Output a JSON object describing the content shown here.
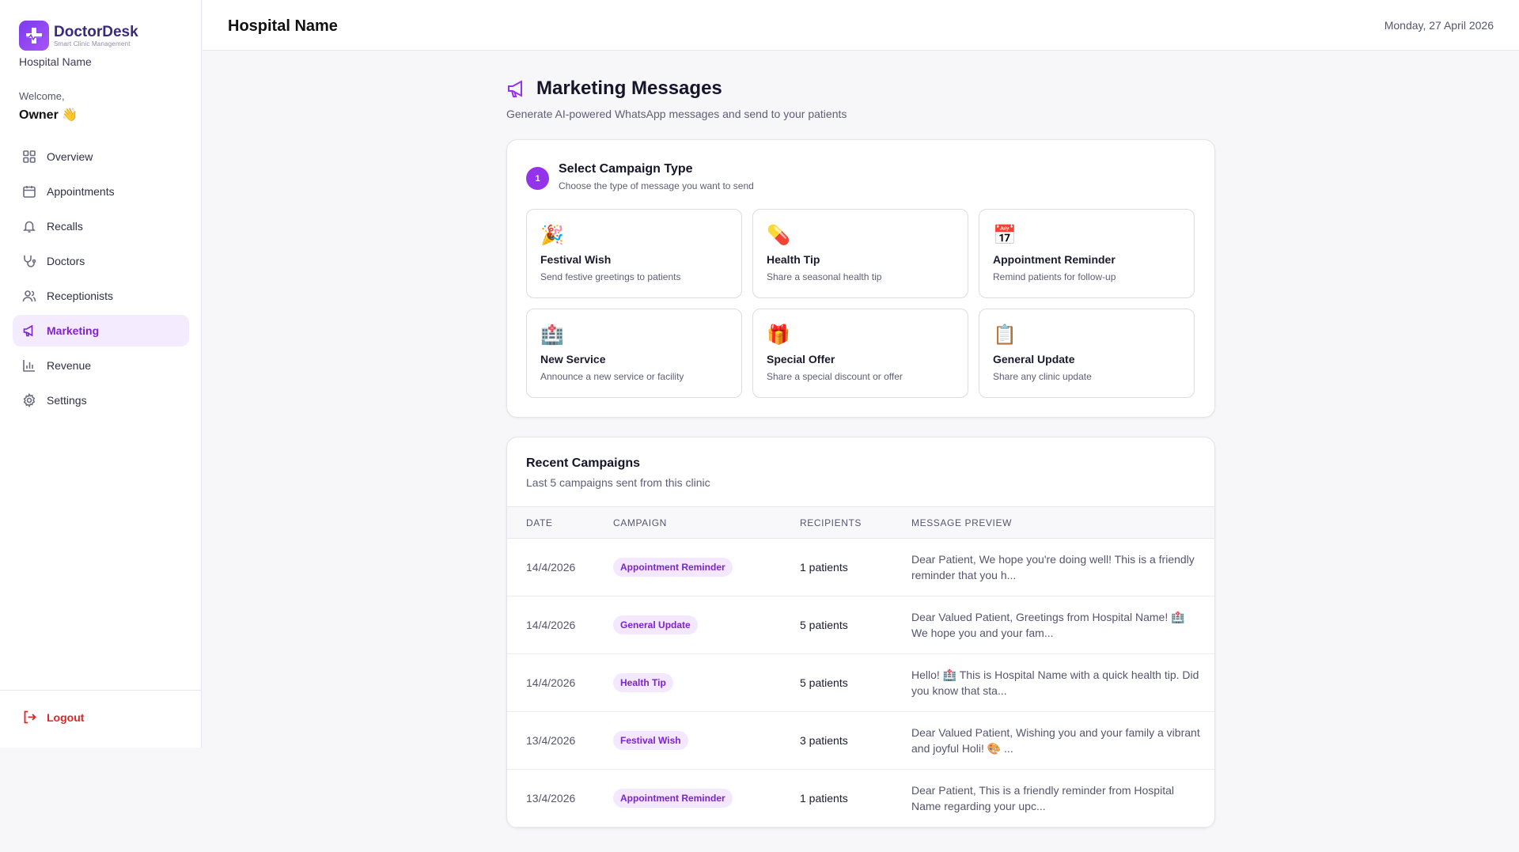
{
  "brand": {
    "name": "DoctorDesk",
    "tagline": "Smart Clinic Management",
    "hospital": "Hospital Name"
  },
  "sidebar": {
    "welcome": "Welcome,",
    "user": "Owner",
    "wave": "👋",
    "items": [
      {
        "label": "Overview",
        "icon": "grid-icon"
      },
      {
        "label": "Appointments",
        "icon": "calendar-icon"
      },
      {
        "label": "Recalls",
        "icon": "bell-icon"
      },
      {
        "label": "Doctors",
        "icon": "stethoscope-icon"
      },
      {
        "label": "Receptionists",
        "icon": "users-icon"
      },
      {
        "label": "Marketing",
        "icon": "megaphone-icon",
        "active": true
      },
      {
        "label": "Revenue",
        "icon": "bar-chart-icon"
      },
      {
        "label": "Settings",
        "icon": "gear-icon"
      }
    ],
    "logout": "Logout"
  },
  "header": {
    "title": "Hospital Name",
    "date": "Monday, 27 April 2026"
  },
  "page": {
    "title": "Marketing Messages",
    "subtitle": "Generate AI-powered WhatsApp messages and send to your patients"
  },
  "campaign": {
    "step": "1",
    "title": "Select Campaign Type",
    "subtitle": "Choose the type of message you want to send",
    "types": [
      {
        "emoji": "🎉",
        "title": "Festival Wish",
        "desc": "Send festive greetings to patients"
      },
      {
        "emoji": "💊",
        "title": "Health Tip",
        "desc": "Share a seasonal health tip"
      },
      {
        "emoji": "📅",
        "title": "Appointment Reminder",
        "desc": "Remind patients for follow-up"
      },
      {
        "emoji": "🏥",
        "title": "New Service",
        "desc": "Announce a new service or facility"
      },
      {
        "emoji": "🎁",
        "title": "Special Offer",
        "desc": "Share a special discount or offer"
      },
      {
        "emoji": "📋",
        "title": "General Update",
        "desc": "Share any clinic update"
      }
    ]
  },
  "recent": {
    "title": "Recent Campaigns",
    "subtitle": "Last 5 campaigns sent from this clinic",
    "columns": [
      "DATE",
      "CAMPAIGN",
      "RECIPIENTS",
      "MESSAGE PREVIEW"
    ],
    "rows": [
      {
        "date": "14/4/2026",
        "campaign": "Appointment Reminder",
        "recipients": "1 patients",
        "preview": "Dear Patient, We hope you're doing well! This is a friendly reminder that you h..."
      },
      {
        "date": "14/4/2026",
        "campaign": "General Update",
        "recipients": "5 patients",
        "preview": "Dear Valued Patient, Greetings from Hospital Name! 🏥 We hope you and your fam..."
      },
      {
        "date": "14/4/2026",
        "campaign": "Health Tip",
        "recipients": "5 patients",
        "preview": "Hello! 🏥 This is Hospital Name with a quick health tip. Did you know that sta..."
      },
      {
        "date": "13/4/2026",
        "campaign": "Festival Wish",
        "recipients": "3 patients",
        "preview": "Dear Valued Patient, Wishing you and your family a vibrant and joyful Holi! 🎨 ..."
      },
      {
        "date": "13/4/2026",
        "campaign": "Appointment Reminder",
        "recipients": "1 patients",
        "preview": "Dear Patient, This is a friendly reminder from Hospital Name regarding your upc..."
      }
    ]
  }
}
